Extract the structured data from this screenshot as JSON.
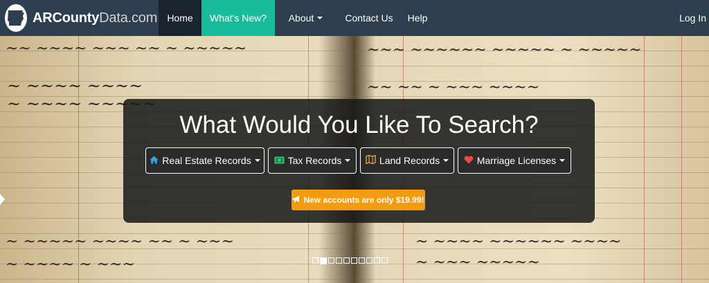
{
  "brand": {
    "name_bold": "ARCounty",
    "name_light": "Data.com"
  },
  "nav": {
    "home": "Home",
    "whats_new": "What's New?",
    "about": "About",
    "contact": "Contact Us",
    "help": "Help",
    "login": "Log In"
  },
  "search": {
    "title": "What Would You Like To Search?",
    "buttons": {
      "real_estate": "Real Estate Records",
      "tax": "Tax Records",
      "land": "Land Records",
      "marriage": "Marriage Licenses"
    },
    "promo": "New accounts are only $19.99!"
  },
  "carousel": {
    "slide_count": 10,
    "active_index": 1
  },
  "icons": {
    "real_estate": "home-icon",
    "tax": "money-icon",
    "land": "map-icon",
    "marriage": "heart-icon",
    "promo": "bullhorn-icon"
  },
  "colors": {
    "navbar": "#2c3e50",
    "nav_active": "#1a242f",
    "accent_green": "#18bc9c",
    "promo_orange": "#f39c12",
    "icon_blue": "#3aa0e0",
    "icon_green": "#2ecc71",
    "icon_orange": "#e8a33c",
    "icon_red": "#e74c3c"
  }
}
